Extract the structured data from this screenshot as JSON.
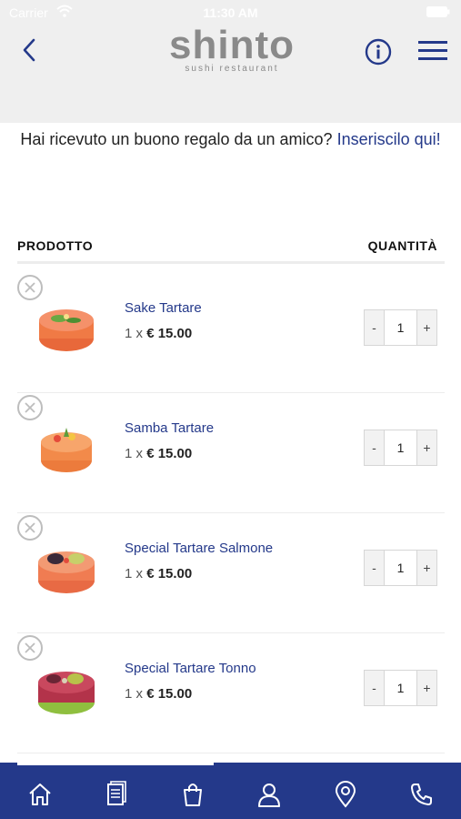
{
  "status_bar": {
    "carrier": "Carrier",
    "time": "11:30 AM"
  },
  "header": {
    "logo_title": "shinto",
    "logo_subtitle": "sushi restaurant"
  },
  "gift_voucher": {
    "prompt": "Hai ricevuto un buono regalo da un amico?",
    "link": "Inseriscilo qui!"
  },
  "cart_table": {
    "col_product": "PRODOTTO",
    "col_quantity": "QUANTITÀ"
  },
  "cart_items": [
    {
      "name": "Sake Tartare",
      "qty_prefix": "1 x",
      "price": "€ 15.00",
      "quantity": "1"
    },
    {
      "name": "Samba Tartare",
      "qty_prefix": "1 x",
      "price": "€ 15.00",
      "quantity": "1"
    },
    {
      "name": "Special Tartare Salmone",
      "qty_prefix": "1 x",
      "price": "€ 15.00",
      "quantity": "1"
    },
    {
      "name": "Special Tartare Tonno",
      "qty_prefix": "1 x",
      "price": "€ 15.00",
      "quantity": "1"
    }
  ],
  "stepper": {
    "minus": "-",
    "plus": "+"
  },
  "tab_bar": {
    "tabs": [
      "home-icon",
      "menu-book-icon",
      "shopping-bag-icon",
      "user-icon",
      "location-pin-icon",
      "phone-icon"
    ],
    "active_tab": "shopping-bag-icon"
  },
  "colors": {
    "accent": "#24398a",
    "header_bg": "#efefef",
    "logo_gray": "#8a8a8a"
  }
}
